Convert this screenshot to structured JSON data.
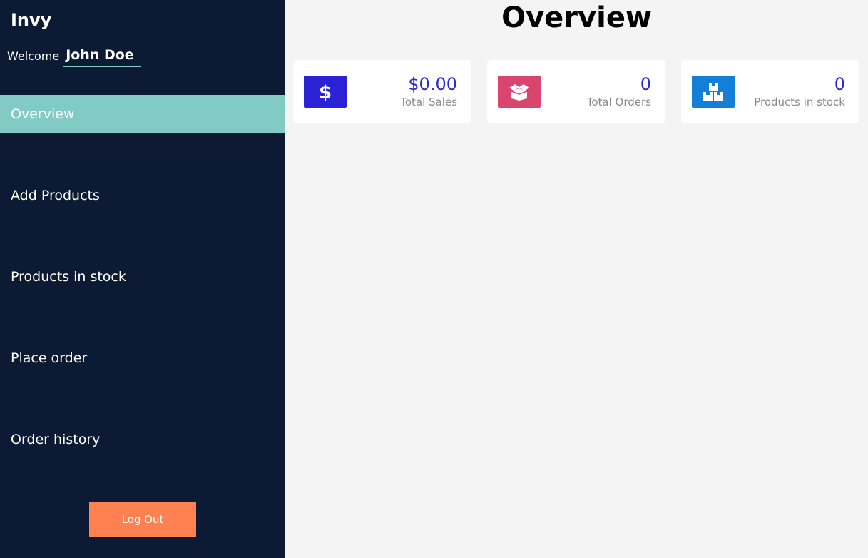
{
  "app": {
    "brand": "Invy"
  },
  "user": {
    "welcome_label": "Welcome",
    "name": "John Doe"
  },
  "sidebar": {
    "items": [
      {
        "label": "Overview",
        "active": true
      },
      {
        "label": "Add Products",
        "active": false
      },
      {
        "label": "Products in stock",
        "active": false
      },
      {
        "label": "Place order",
        "active": false
      },
      {
        "label": "Order history",
        "active": false
      }
    ],
    "logout_label": "Log Out"
  },
  "main": {
    "title": "Overview",
    "cards": [
      {
        "value": "$0.00",
        "label": "Total Sales",
        "icon": "dollar-icon",
        "color": "#2b22d6"
      },
      {
        "value": "0",
        "label": "Total Orders",
        "icon": "open-box-icon",
        "color": "#d9456f"
      },
      {
        "value": "0",
        "label": "Products in stock",
        "icon": "boxes-icon",
        "color": "#137fd6"
      }
    ]
  },
  "colors": {
    "sidebar_bg": "#0c1b33",
    "active_item": "#82cbc4",
    "logout": "#ff8151",
    "value_text": "#2b2bd1"
  }
}
